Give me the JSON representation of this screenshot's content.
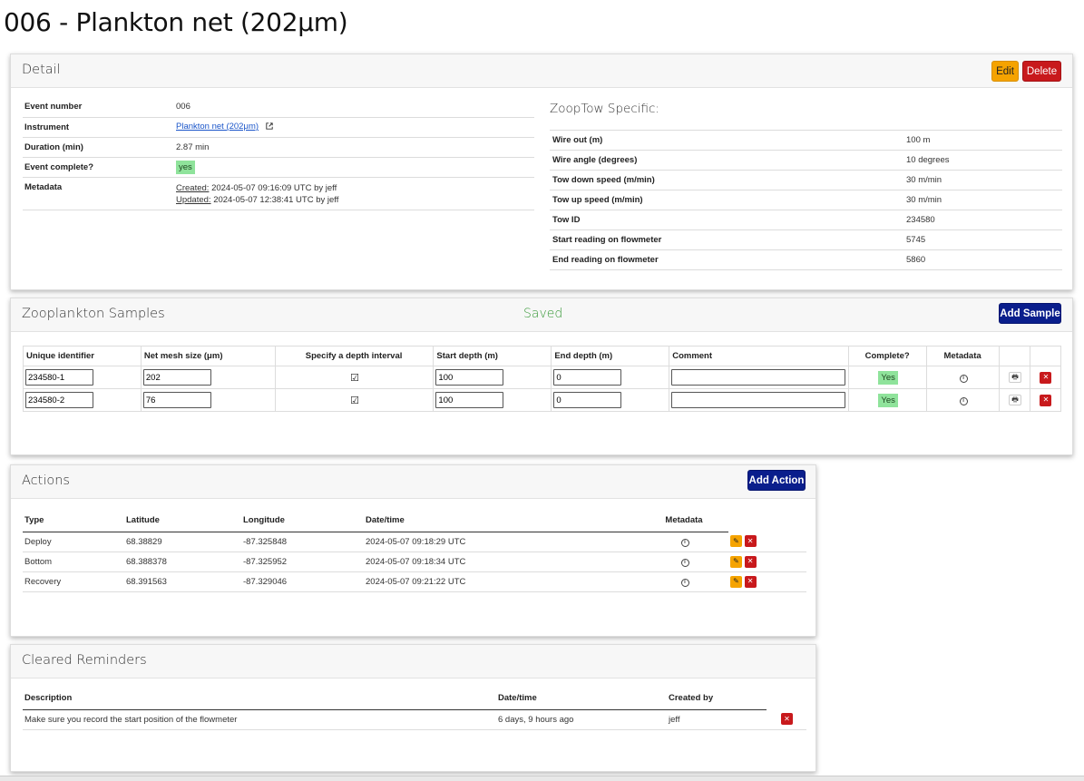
{
  "page": {
    "title": "006 - Plankton net (202μm)"
  },
  "detail": {
    "title": "Detail",
    "edit_label": "Edit",
    "delete_label": "Delete",
    "fields": [
      {
        "label": "Event number",
        "value": "006"
      },
      {
        "label": "Instrument",
        "value": "Plankton net (202μm)"
      },
      {
        "label": "Duration (min)",
        "value": "2.87 min"
      },
      {
        "label": "Event complete?",
        "value": "yes"
      },
      {
        "label": "Metadata",
        "created_label": "Created:",
        "created_value": "2024-05-07 09:16:09 UTC by jeff",
        "updated_label": "Updated:",
        "updated_value": "2024-05-07 12:38:41 UTC by jeff"
      }
    ],
    "specific_title": "ZoopTow Specific:",
    "specific": [
      {
        "label": "Wire out (m)",
        "value": "100 m"
      },
      {
        "label": "Wire angle (degrees)",
        "value": "10 degrees"
      },
      {
        "label": "Tow down speed (m/min)",
        "value": "30 m/min"
      },
      {
        "label": "Tow up speed (m/min)",
        "value": "30 m/min"
      },
      {
        "label": "Tow ID",
        "value": "234580"
      },
      {
        "label": "Start reading on flowmeter",
        "value": "5745"
      },
      {
        "label": "End reading on flowmeter",
        "value": "5860"
      }
    ]
  },
  "samples": {
    "title": "Zooplankton Samples",
    "status": "Saved",
    "add_label": "Add Sample",
    "headers": [
      "Unique identifier",
      "Net mesh size (μm)",
      "Specify a depth interval",
      "Start depth (m)",
      "End depth (m)",
      "Comment",
      "Complete?",
      "Metadata"
    ],
    "rows": [
      {
        "id": "234580-1",
        "mesh": "202",
        "depth_interval": "☑",
        "start": "100",
        "end": "0",
        "comment": "",
        "complete": "Yes"
      },
      {
        "id": "234580-2",
        "mesh": "76",
        "depth_interval": "☑",
        "start": "100",
        "end": "0",
        "comment": "",
        "complete": "Yes"
      }
    ]
  },
  "actions": {
    "title": "Actions",
    "add_label": "Add Action",
    "headers": [
      "Type",
      "Latitude",
      "Longitude",
      "Date/time",
      "Metadata"
    ],
    "rows": [
      {
        "type": "Deploy",
        "lat": "68.38829",
        "lon": "-87.325848",
        "datetime": "2024-05-07 09:18:29 UTC"
      },
      {
        "type": "Bottom",
        "lat": "68.388378",
        "lon": "-87.325952",
        "datetime": "2024-05-07 09:18:34 UTC"
      },
      {
        "type": "Recovery",
        "lat": "68.391563",
        "lon": "-87.329046",
        "datetime": "2024-05-07 09:21:22 UTC"
      }
    ]
  },
  "reminders": {
    "title": "Cleared Reminders",
    "headers": [
      "Description",
      "Date/time",
      "Created by"
    ],
    "rows": [
      {
        "description": "Make sure you record the start position of the flowmeter",
        "datetime": "6 days, 9 hours ago",
        "created_by": "jeff"
      }
    ]
  },
  "icons": {
    "external_link": "external-link-icon",
    "info": "info-icon",
    "print": "print-icon",
    "delete": "close-icon",
    "edit": "pencil-icon"
  },
  "colors": {
    "edit": "#f5a300",
    "delete": "#c8191c",
    "primary": "#0a1e8c",
    "saved": "#3a9a3a",
    "yes_badge": "#8fe39b"
  }
}
